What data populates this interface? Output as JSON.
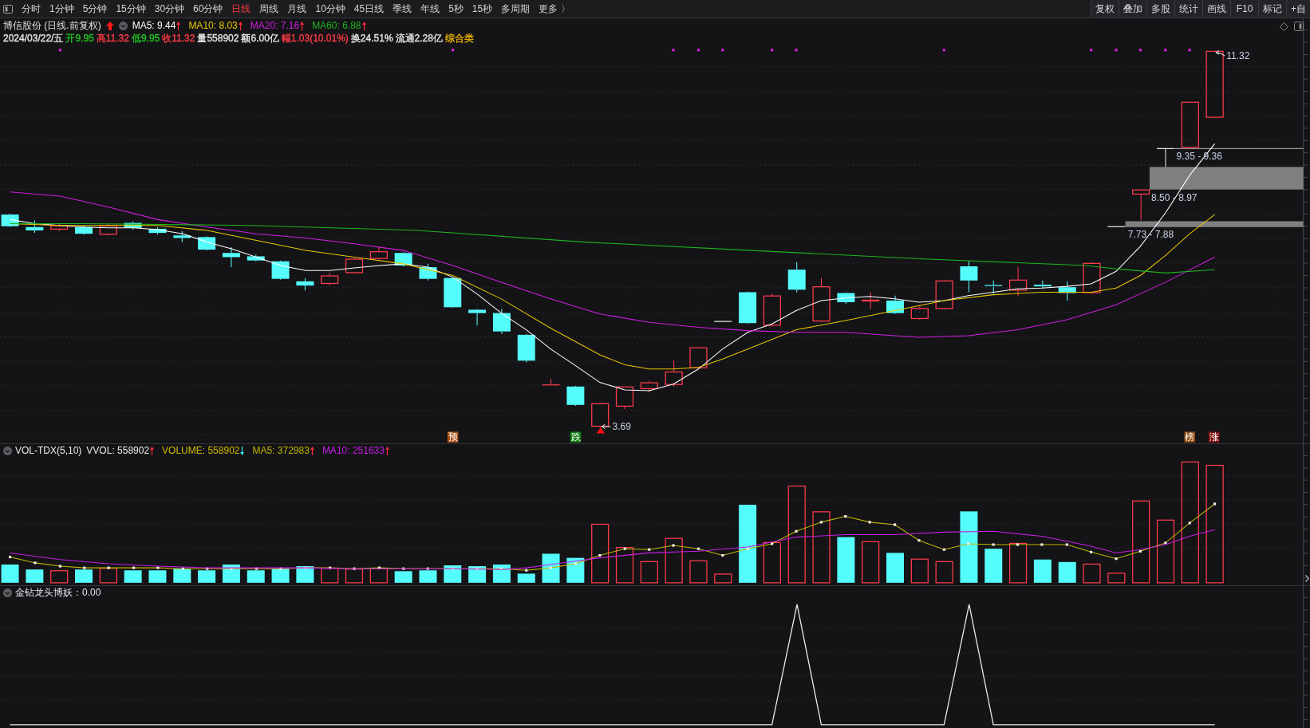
{
  "toolbar": {
    "tabs": [
      {
        "label": "分时",
        "selected": false
      },
      {
        "label": "1分钟",
        "selected": false
      },
      {
        "label": "5分钟",
        "selected": false
      },
      {
        "label": "15分钟",
        "selected": false
      },
      {
        "label": "30分钟",
        "selected": false
      },
      {
        "label": "60分钟",
        "selected": false
      },
      {
        "label": "日线",
        "selected": true
      },
      {
        "label": "周线",
        "selected": false
      },
      {
        "label": "月线",
        "selected": false
      },
      {
        "label": "10分钟",
        "selected": false
      },
      {
        "label": "45日线",
        "selected": false
      },
      {
        "label": "季线",
        "selected": false
      },
      {
        "label": "年线",
        "selected": false
      },
      {
        "label": "5秒",
        "selected": false
      },
      {
        "label": "15秒",
        "selected": false
      },
      {
        "label": "多周期",
        "selected": false
      },
      {
        "label": "更多 〉",
        "selected": false
      }
    ],
    "buttons": [
      "复权",
      "叠加",
      "多股",
      "统计",
      "画线",
      "F10",
      "标记",
      "+自"
    ]
  },
  "main_chart": {
    "title": "博信股份 (日线.前复权)",
    "rising": true,
    "indicators": [
      {
        "label": "MA5: 9.44",
        "color": "#ffffff",
        "rising": true
      },
      {
        "label": "MA10: 8.03",
        "color": "#e6c800",
        "rising": true
      },
      {
        "label": "MA20: 7.16",
        "color": "#d01ee0",
        "rising": true
      },
      {
        "label": "MA60: 6.88",
        "color": "#1eb41e",
        "rising": true
      }
    ],
    "quote": [
      {
        "text": "2024/03/22/五",
        "color": "#e6e6e6"
      },
      {
        "text": "开9.95",
        "color": "#22c422"
      },
      {
        "text": "高11.32",
        "color": "#ff3c46"
      },
      {
        "text": "低9.95",
        "color": "#22c422"
      },
      {
        "text": "收11.32",
        "color": "#ff3c46"
      },
      {
        "text": "量558902",
        "color": "#e6e6e6"
      },
      {
        "text": "额6.00亿",
        "color": "#e6e6e6"
      },
      {
        "text": "幅1.03(10.01%)",
        "color": "#ff3c46"
      },
      {
        "text": "换24.51%",
        "color": "#e6e6e6"
      },
      {
        "text": "流通2.28亿",
        "color": "#e6e6e6"
      },
      {
        "text": "综合类",
        "color": "#f0b400"
      }
    ],
    "price_labels": [
      "11.32",
      "9.35 - 9.36",
      "8.50 - 8.97",
      "7.73 - 7.88",
      "3.69"
    ],
    "signal_tags": [
      {
        "text": "预",
        "color": "#a84c12"
      },
      {
        "text": "跌",
        "color": "#0e7a0e"
      },
      {
        "text": "榜",
        "color": "#8c4a10"
      },
      {
        "text": "涨",
        "color": "#7c0c0c"
      }
    ]
  },
  "volume_chart": {
    "title": "VOL-TDX(5,10)",
    "indicators": [
      {
        "label": "VVOL: 558902",
        "color": "#ececec",
        "rising": true
      },
      {
        "label": "VOLUME: 558902",
        "color": "#d2be00",
        "rising": false
      },
      {
        "label": "MA5: 372983",
        "color": "#c0b800",
        "rising": true
      },
      {
        "label": "MA10: 251633",
        "color": "#c81ee6",
        "rising": true
      }
    ]
  },
  "indicator_chart": {
    "title": "金钻龙头博妖：0.00"
  }
}
